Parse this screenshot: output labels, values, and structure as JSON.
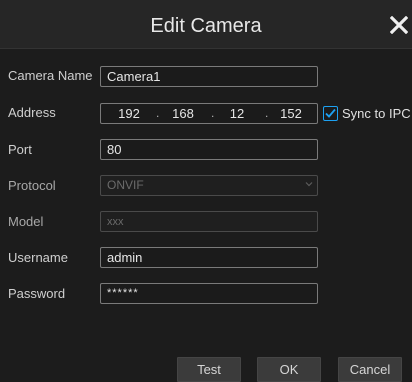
{
  "dialog": {
    "title": "Edit Camera",
    "close_glyph": "✕"
  },
  "fields": {
    "camera_name": {
      "label": "Camera Name",
      "value": "Camera1"
    },
    "address": {
      "label": "Address",
      "octets": [
        "192",
        "168",
        "12",
        "152"
      ],
      "separator": ".",
      "sync_label": "Sync to IPC",
      "sync_checked": true
    },
    "port": {
      "label": "Port",
      "value": "80"
    },
    "protocol": {
      "label": "Protocol",
      "value": "ONVIF"
    },
    "model": {
      "label": "Model",
      "value": "xxx"
    },
    "username": {
      "label": "Username",
      "value": "admin"
    },
    "password": {
      "label": "Password",
      "value": "******"
    }
  },
  "buttons": {
    "test": "Test",
    "ok": "OK",
    "cancel": "Cancel"
  },
  "colors": {
    "accent": "#1da1f2",
    "background": "#1c1c1c",
    "titlebar": "#262626"
  },
  "icons": {
    "close": "close-icon",
    "dropdown": "chevron-down-icon",
    "check": "checkmark-icon"
  }
}
